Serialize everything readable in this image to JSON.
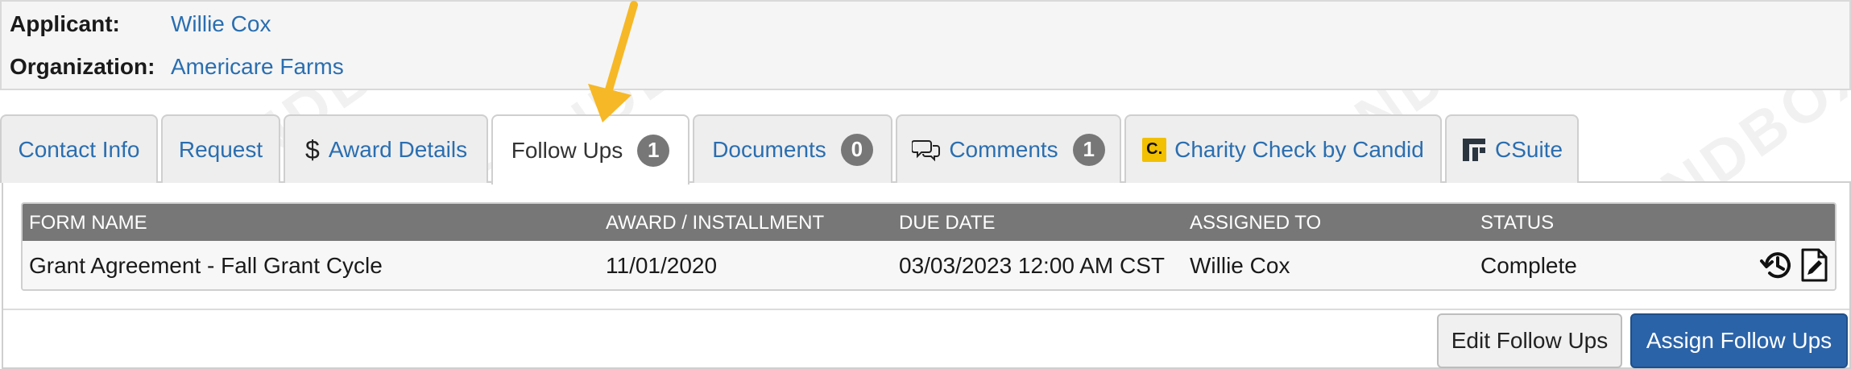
{
  "header": {
    "applicant_label": "Applicant:",
    "applicant_value": "Willie Cox",
    "organization_label": "Organization:",
    "organization_value": "Americare Farms"
  },
  "tabs": [
    {
      "label": "Contact Info"
    },
    {
      "label": "Request"
    },
    {
      "label": "Award Details",
      "icon": "dollar-icon"
    },
    {
      "label": "Follow Ups",
      "badge": "1",
      "active": true
    },
    {
      "label": "Documents",
      "badge": "0"
    },
    {
      "label": "Comments",
      "badge": "1",
      "icon": "comments-icon"
    },
    {
      "label": "Charity Check by Candid",
      "icon": "charity-check-icon",
      "icon_text": "C."
    },
    {
      "label": "CSuite",
      "icon": "csuite-icon"
    }
  ],
  "table": {
    "columns": [
      "FORM NAME",
      "AWARD / INSTALLMENT",
      "DUE DATE",
      "ASSIGNED TO",
      "STATUS"
    ],
    "rows": [
      [
        "Grant Agreement - Fall Grant Cycle",
        "11/01/2020",
        "03/03/2023 12:00 AM CST",
        "Willie Cox",
        "Complete"
      ]
    ]
  },
  "buttons": {
    "edit": "Edit Follow Ups",
    "assign": "Assign Follow Ups"
  },
  "watermark_text": "SANDBOX",
  "colors": {
    "link": "#2a6eb0",
    "table_header": "#777777",
    "primary_button": "#2b63a8",
    "annotation_arrow": "#f6b826"
  }
}
